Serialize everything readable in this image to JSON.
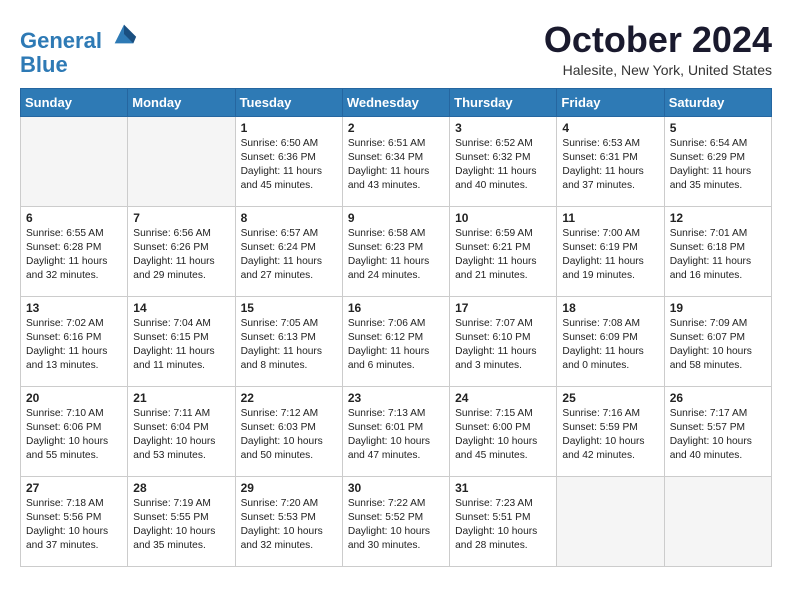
{
  "header": {
    "logo_line1": "General",
    "logo_line2": "Blue",
    "month_title": "October 2024",
    "location": "Halesite, New York, United States"
  },
  "weekdays": [
    "Sunday",
    "Monday",
    "Tuesday",
    "Wednesday",
    "Thursday",
    "Friday",
    "Saturday"
  ],
  "weeks": [
    [
      {
        "day": "",
        "info": ""
      },
      {
        "day": "",
        "info": ""
      },
      {
        "day": "1",
        "info": "Sunrise: 6:50 AM\nSunset: 6:36 PM\nDaylight: 11 hours and 45 minutes."
      },
      {
        "day": "2",
        "info": "Sunrise: 6:51 AM\nSunset: 6:34 PM\nDaylight: 11 hours and 43 minutes."
      },
      {
        "day": "3",
        "info": "Sunrise: 6:52 AM\nSunset: 6:32 PM\nDaylight: 11 hours and 40 minutes."
      },
      {
        "day": "4",
        "info": "Sunrise: 6:53 AM\nSunset: 6:31 PM\nDaylight: 11 hours and 37 minutes."
      },
      {
        "day": "5",
        "info": "Sunrise: 6:54 AM\nSunset: 6:29 PM\nDaylight: 11 hours and 35 minutes."
      }
    ],
    [
      {
        "day": "6",
        "info": "Sunrise: 6:55 AM\nSunset: 6:28 PM\nDaylight: 11 hours and 32 minutes."
      },
      {
        "day": "7",
        "info": "Sunrise: 6:56 AM\nSunset: 6:26 PM\nDaylight: 11 hours and 29 minutes."
      },
      {
        "day": "8",
        "info": "Sunrise: 6:57 AM\nSunset: 6:24 PM\nDaylight: 11 hours and 27 minutes."
      },
      {
        "day": "9",
        "info": "Sunrise: 6:58 AM\nSunset: 6:23 PM\nDaylight: 11 hours and 24 minutes."
      },
      {
        "day": "10",
        "info": "Sunrise: 6:59 AM\nSunset: 6:21 PM\nDaylight: 11 hours and 21 minutes."
      },
      {
        "day": "11",
        "info": "Sunrise: 7:00 AM\nSunset: 6:19 PM\nDaylight: 11 hours and 19 minutes."
      },
      {
        "day": "12",
        "info": "Sunrise: 7:01 AM\nSunset: 6:18 PM\nDaylight: 11 hours and 16 minutes."
      }
    ],
    [
      {
        "day": "13",
        "info": "Sunrise: 7:02 AM\nSunset: 6:16 PM\nDaylight: 11 hours and 13 minutes."
      },
      {
        "day": "14",
        "info": "Sunrise: 7:04 AM\nSunset: 6:15 PM\nDaylight: 11 hours and 11 minutes."
      },
      {
        "day": "15",
        "info": "Sunrise: 7:05 AM\nSunset: 6:13 PM\nDaylight: 11 hours and 8 minutes."
      },
      {
        "day": "16",
        "info": "Sunrise: 7:06 AM\nSunset: 6:12 PM\nDaylight: 11 hours and 6 minutes."
      },
      {
        "day": "17",
        "info": "Sunrise: 7:07 AM\nSunset: 6:10 PM\nDaylight: 11 hours and 3 minutes."
      },
      {
        "day": "18",
        "info": "Sunrise: 7:08 AM\nSunset: 6:09 PM\nDaylight: 11 hours and 0 minutes."
      },
      {
        "day": "19",
        "info": "Sunrise: 7:09 AM\nSunset: 6:07 PM\nDaylight: 10 hours and 58 minutes."
      }
    ],
    [
      {
        "day": "20",
        "info": "Sunrise: 7:10 AM\nSunset: 6:06 PM\nDaylight: 10 hours and 55 minutes."
      },
      {
        "day": "21",
        "info": "Sunrise: 7:11 AM\nSunset: 6:04 PM\nDaylight: 10 hours and 53 minutes."
      },
      {
        "day": "22",
        "info": "Sunrise: 7:12 AM\nSunset: 6:03 PM\nDaylight: 10 hours and 50 minutes."
      },
      {
        "day": "23",
        "info": "Sunrise: 7:13 AM\nSunset: 6:01 PM\nDaylight: 10 hours and 47 minutes."
      },
      {
        "day": "24",
        "info": "Sunrise: 7:15 AM\nSunset: 6:00 PM\nDaylight: 10 hours and 45 minutes."
      },
      {
        "day": "25",
        "info": "Sunrise: 7:16 AM\nSunset: 5:59 PM\nDaylight: 10 hours and 42 minutes."
      },
      {
        "day": "26",
        "info": "Sunrise: 7:17 AM\nSunset: 5:57 PM\nDaylight: 10 hours and 40 minutes."
      }
    ],
    [
      {
        "day": "27",
        "info": "Sunrise: 7:18 AM\nSunset: 5:56 PM\nDaylight: 10 hours and 37 minutes."
      },
      {
        "day": "28",
        "info": "Sunrise: 7:19 AM\nSunset: 5:55 PM\nDaylight: 10 hours and 35 minutes."
      },
      {
        "day": "29",
        "info": "Sunrise: 7:20 AM\nSunset: 5:53 PM\nDaylight: 10 hours and 32 minutes."
      },
      {
        "day": "30",
        "info": "Sunrise: 7:22 AM\nSunset: 5:52 PM\nDaylight: 10 hours and 30 minutes."
      },
      {
        "day": "31",
        "info": "Sunrise: 7:23 AM\nSunset: 5:51 PM\nDaylight: 10 hours and 28 minutes."
      },
      {
        "day": "",
        "info": ""
      },
      {
        "day": "",
        "info": ""
      }
    ]
  ]
}
